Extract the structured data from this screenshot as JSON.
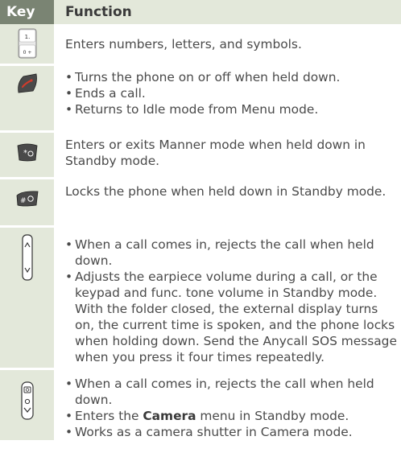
{
  "header": {
    "key": "Key",
    "function": "Function"
  },
  "rows": [
    {
      "icon": "numeric-keypad-key-icon",
      "text": "Enters numbers, letters, and symbols."
    },
    {
      "icon": "power-end-key-icon",
      "bullets": [
        "Turns the phone on or off when held down.",
        "Ends a call.",
        "Returns to Idle mode from Menu mode."
      ]
    },
    {
      "icon": "star-manner-key-icon",
      "text": "Enters or exits Manner mode when held down in Standby mode."
    },
    {
      "icon": "hash-lock-key-icon",
      "text": "Locks the phone when held down in Standby mode."
    },
    {
      "icon": "volume-side-key-icon",
      "bullets": [
        "When a call comes in, rejects the call when held down.",
        "Adjusts the earpiece volume during a call, or the keypad and func. tone volume in Standby mode. With the folder closed, the external display turns on, the current time is spoken, and the phone locks when holding down. Send the Anycall SOS message when you press it four times repeatedly."
      ]
    },
    {
      "icon": "camera-side-key-icon",
      "bullets_pre": "When a call comes in, rejects the call when held down.",
      "camera_prefix": "Enters the ",
      "camera_bold": "Camera",
      "camera_suffix": " menu in Standby mode.",
      "bullets_post": "Works as a camera shutter in Camera mode."
    }
  ]
}
